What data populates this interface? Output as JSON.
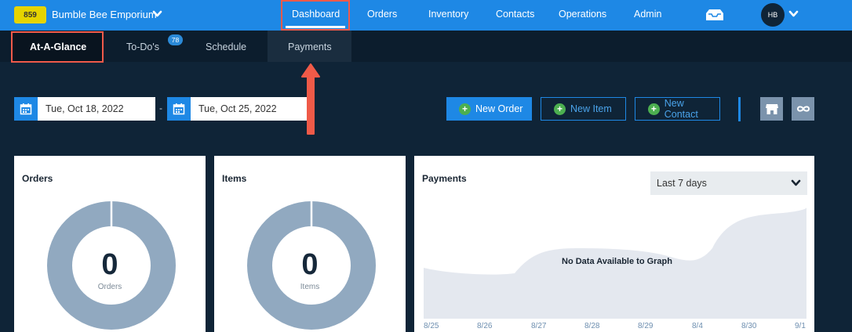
{
  "header": {
    "badge": "859",
    "company_name": "Bumble Bee Emporium",
    "nav": [
      "Dashboard",
      "Orders",
      "Inventory",
      "Contacts",
      "Operations",
      "Admin"
    ],
    "active_nav": "Dashboard",
    "avatar_initials": "HB"
  },
  "subnav": {
    "tabs": [
      "At-A-Glance",
      "To-Do's",
      "Schedule",
      "Payments"
    ],
    "active_tab": "At-A-Glance",
    "todo_count": "78"
  },
  "filters": {
    "start_date": "Tue, Oct 18, 2022",
    "separator": "-",
    "end_date": "Tue, Oct 25, 2022"
  },
  "actions": {
    "new_order": "New Order",
    "new_item": "New Item",
    "new_contact": "New Contact"
  },
  "cards": {
    "orders": {
      "title": "Orders",
      "value": "0",
      "label": "Orders"
    },
    "items": {
      "title": "Items",
      "value": "0",
      "label": "Items"
    },
    "payments": {
      "title": "Payments",
      "range": "Last 7 days",
      "message": "No Data Available to Graph",
      "x_ticks": [
        "8/25",
        "8/26",
        "8/27",
        "8/28",
        "8/29",
        "8/4",
        "8/30",
        "9/1"
      ]
    }
  },
  "colors": {
    "topbar": "#1e88e5",
    "highlight": "#f05a4a",
    "donut": "#91a9c0",
    "area": "#e4e8ef"
  },
  "icons": {
    "date": "calendar-icon",
    "inbox": "inbox-icon",
    "store": "store-icon",
    "link": "infinity-icon"
  }
}
